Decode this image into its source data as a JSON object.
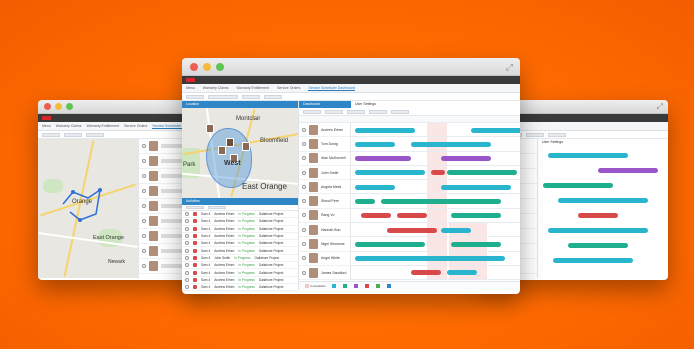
{
  "colors": {
    "background": "#ff6a00",
    "accent": "#2f86c6",
    "bar_cyan": "#2ab5cf",
    "bar_teal": "#1faf8f",
    "bar_purple": "#9a55c8",
    "bar_red": "#d84a4a"
  },
  "icons": {
    "maximize": "expand-icon",
    "close": "window-close-dot",
    "minimize": "window-minimize-dot",
    "zoom": "window-zoom-dot"
  },
  "center": {
    "menubar": [
      "",
      "",
      "",
      "",
      ""
    ],
    "tabs": [
      "Menu",
      "Warranty Claims",
      "Warranty Entitlement",
      "Service Orders",
      "Service Scheduler Dashboard"
    ],
    "map_panel_title": "Location",
    "map_labels": {
      "park": "Park",
      "montclair": "Montclair",
      "bloomfield": "Bloomfield",
      "west": "West",
      "east_orange": "East Orange"
    },
    "activities_title": "Activities",
    "table_rows": [
      {
        "id": "Sam 4",
        "name": "Andrew Erben",
        "status": "In Progress",
        "desc": "Gallahore Project"
      },
      {
        "id": "Sam 4",
        "name": "Andrew Erben",
        "status": "In Progress",
        "desc": "Gallahore Project"
      },
      {
        "id": "Sam 4",
        "name": "Andrew Erben",
        "status": "In Progress",
        "desc": "Gallahore Project"
      },
      {
        "id": "Sam 4",
        "name": "Andrew Erben",
        "status": "In Progress",
        "desc": "Gallahore Project"
      },
      {
        "id": "Sam 4",
        "name": "Andrew Erben",
        "status": "In Progress",
        "desc": "Gallahore Project"
      },
      {
        "id": "Sam 4",
        "name": "Andrew Erben",
        "status": "In Progress",
        "desc": "Gallahore Project"
      },
      {
        "id": "Sam 4",
        "name": "John Smith",
        "status": "In Progress",
        "desc": "Gallahore Project"
      },
      {
        "id": "Sam 4",
        "name": "Andrew Erben",
        "status": "In Progress",
        "desc": "Gallahore Project"
      },
      {
        "id": "Sam 4",
        "name": "Andrew Erben",
        "status": "In Progress",
        "desc": "Gallahore Project"
      },
      {
        "id": "Sam 4",
        "name": "Andrew Erben",
        "status": "In Progress",
        "desc": "Gallahore Project"
      },
      {
        "id": "Sam 4",
        "name": "Andrew Erben",
        "status": "In Progress",
        "desc": "Gallahore Project"
      }
    ],
    "gantt_panel_title": "Dashboard",
    "gantt_panel_tab": "User Settings",
    "engineers": [
      {
        "name": "Andrew Erben",
        "role": ""
      },
      {
        "name": "Tom Donig",
        "role": ""
      },
      {
        "name": "Alan McDonnell",
        "role": ""
      },
      {
        "name": "John Smith",
        "role": ""
      },
      {
        "name": "Angela Meek",
        "role": ""
      },
      {
        "name": "Shusil Pere",
        "role": ""
      },
      {
        "name": "Rang Vo",
        "role": ""
      },
      {
        "name": "Hannah Bun",
        "role": ""
      },
      {
        "name": "Nigel Simmons",
        "role": ""
      },
      {
        "name": "Angel White",
        "role": ""
      },
      {
        "name": "James Sandford",
        "role": ""
      }
    ],
    "legend": [
      "Unavailable",
      "",
      "",
      "",
      "",
      "",
      ""
    ]
  },
  "left": {
    "tabs": [
      "Menu",
      "Warranty Claims",
      "Warranty Entitlement",
      "Service Orders",
      "Service Scheduler Dashboard"
    ],
    "map_labels": {
      "orange": "Orange",
      "east_orange": "East Orange",
      "newark": "Newark"
    }
  },
  "right": {
    "tab": "User Settings"
  }
}
